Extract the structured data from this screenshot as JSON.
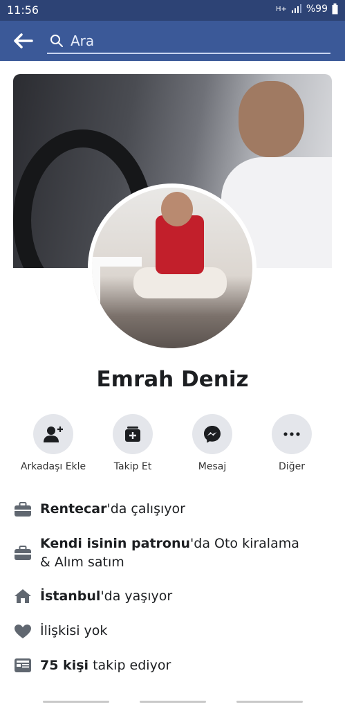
{
  "status_bar": {
    "time": "11:56",
    "network": "H+",
    "battery": "%99"
  },
  "header": {
    "search_placeholder": "Ara"
  },
  "profile": {
    "name": "Emrah Deniz"
  },
  "actions": [
    {
      "label": "Arkadaşı Ekle",
      "icon": "add-friend-icon"
    },
    {
      "label": "Takip Et",
      "icon": "follow-icon"
    },
    {
      "label": "Mesaj",
      "icon": "messenger-icon"
    },
    {
      "label": "Diğer",
      "icon": "more-icon"
    }
  ],
  "info": {
    "work1": {
      "bold": "Rentecar",
      "rest": "'da çalışıyor"
    },
    "work2": {
      "bold": "Kendi isinin patronu",
      "rest": "'da Oto kiralama & Alım satım"
    },
    "home": {
      "bold": "İstanbul",
      "rest": "'da yaşıyor"
    },
    "relationship": {
      "text": "İlişkisi yok"
    },
    "followers": {
      "bold": "75 kişi",
      "rest": " takip ediyor"
    }
  },
  "colors": {
    "header": "#3b5998",
    "status_bar": "#2d4375",
    "icon_gray": "#606770"
  }
}
